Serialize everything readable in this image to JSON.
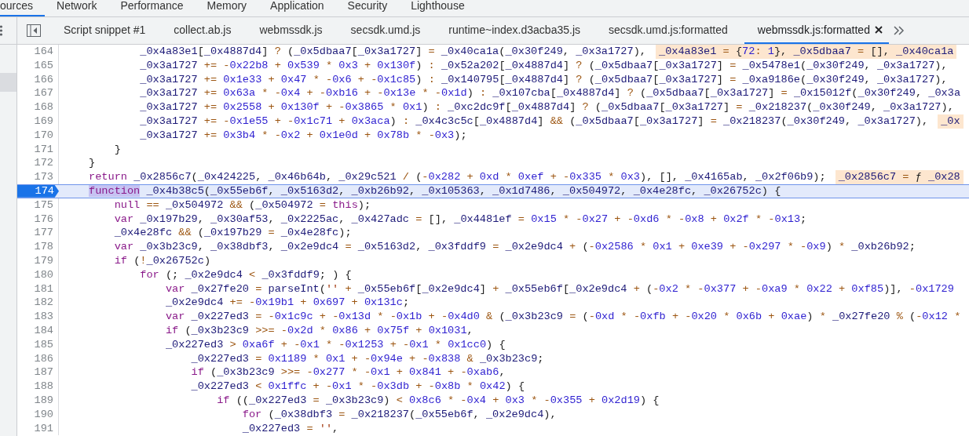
{
  "panel_tabs": [
    {
      "label": "ources",
      "selected": true
    },
    {
      "label": "Network",
      "selected": false
    },
    {
      "label": "Performance",
      "selected": false
    },
    {
      "label": "Memory",
      "selected": false
    },
    {
      "label": "Application",
      "selected": false
    },
    {
      "label": "Security",
      "selected": false
    },
    {
      "label": "Lighthouse",
      "selected": false
    }
  ],
  "sidebar": {
    "rows": [
      {
        "selected": true
      }
    ]
  },
  "file_tabs": [
    {
      "label": "Script snippet #1",
      "selected": false
    },
    {
      "label": "collect.ab.js",
      "selected": false
    },
    {
      "label": "webmssdk.js",
      "selected": false
    },
    {
      "label": "secsdk.umd.js",
      "selected": false
    },
    {
      "label": "runtime~index.d3acba35.js",
      "selected": false
    },
    {
      "label": "secsdk.umd.js:formatted",
      "selected": false
    },
    {
      "label": "webmssdk.js:formatted",
      "selected": true
    }
  ],
  "editor": {
    "lines": [
      {
        "number": "164",
        "breakpoint": false,
        "text": "        _0x4a83e1[_0x4887d4] ? (_0x5dbaa7[_0x3a1727] = _0x40ca1a(_0x30f249, _0x3a1727),",
        "inline_value": "_0x4a83e1 = {72: 1}, _0x5dbaa7 = [], _0x40ca1a"
      },
      {
        "number": "165",
        "breakpoint": false,
        "text": "        _0x3a1727 += -0x22b8 + 0x539 * 0x3 + 0x130f) : _0x52a202[_0x4887d4] ? (_0x5dbaa7[_0x3a1727] = _0x5478e1(_0x30f249, _0x3a1727),"
      },
      {
        "number": "166",
        "breakpoint": false,
        "text": "        _0x3a1727 += 0x1e33 + 0x47 * -0x6 + -0x1c85) : _0x140795[_0x4887d4] ? (_0x5dbaa7[_0x3a1727] = _0xa9186e(_0x30f249, _0x3a1727),"
      },
      {
        "number": "167",
        "breakpoint": false,
        "text": "        _0x3a1727 += 0x63a * -0x4 + -0xb16 + -0x13e * -0x1d) : _0x107cba[_0x4887d4] ? (_0x5dbaa7[_0x3a1727] = _0x15012f(_0x30f249, _0x3a"
      },
      {
        "number": "168",
        "breakpoint": false,
        "text": "        _0x3a1727 += 0x2558 + 0x130f + -0x3865 * 0x1) : _0xc2dc9f[_0x4887d4] ? (_0x5dbaa7[_0x3a1727] = _0x218237(_0x30f249, _0x3a1727),"
      },
      {
        "number": "169",
        "breakpoint": false,
        "text": "        _0x3a1727 += -0x1e55 + -0x1c71 + 0x3aca) : _0x4c3c5c[_0x4887d4] && (_0x5dbaa7[_0x3a1727] = _0x218237(_0x30f249, _0x3a1727),",
        "inline_value": "_0x"
      },
      {
        "number": "170",
        "breakpoint": false,
        "text": "        _0x3a1727 += 0x3b4 * -0x2 + 0x1e0d + 0x78b * -0x3);"
      },
      {
        "number": "171",
        "breakpoint": false,
        "text": "    }"
      },
      {
        "number": "172",
        "breakpoint": false,
        "text": "}"
      },
      {
        "number": "173",
        "breakpoint": false,
        "text": "return _0x2856c7(_0x424225, _0x46b64b, _0x29c521 / (-0x282 + 0xd * 0xef + -0x335 * 0x3), [], _0x4165ab, _0x2f06b9);",
        "inline_value": "_0x2856c7 = ƒ _0x28"
      },
      {
        "number": "174",
        "breakpoint": true,
        "match": "function",
        "text": " _0x4b38c5(_0x55eb6f, _0x5163d2, _0xb26b92, _0x105363, _0x1d7486, _0x504972, _0x4e28fc, _0x26752c) {"
      },
      {
        "number": "175",
        "breakpoint": false,
        "text": "    null == _0x504972 && (_0x504972 = this);"
      },
      {
        "number": "176",
        "breakpoint": false,
        "text": "    var _0x197b29, _0x30af53, _0x2225ac, _0x427adc = [], _0x4481ef = 0x15 * -0x27 + -0xd6 * -0x8 + 0x2f * -0x13;"
      },
      {
        "number": "177",
        "breakpoint": false,
        "text": "    _0x4e28fc && (_0x197b29 = _0x4e28fc);"
      },
      {
        "number": "178",
        "breakpoint": false,
        "text": "    var _0x3b23c9, _0x38dbf3, _0x2e9dc4 = _0x5163d2, _0x3fddf9 = _0x2e9dc4 + (-0x2586 * 0x1 + 0xe39 + -0x297 * -0x9) * _0xb26b92;"
      },
      {
        "number": "179",
        "breakpoint": false,
        "text": "    if (!_0x26752c)"
      },
      {
        "number": "180",
        "breakpoint": false,
        "text": "        for (; _0x2e9dc4 < _0x3fddf9; ) {"
      },
      {
        "number": "181",
        "breakpoint": false,
        "text": "            var _0x27fe20 = parseInt('' + _0x55eb6f[_0x2e9dc4] + _0x55eb6f[_0x2e9dc4 + (-0x2 * -0x377 + -0xa9 * 0x22 + 0xf85)], -0x1729"
      },
      {
        "number": "182",
        "breakpoint": false,
        "text": "            _0x2e9dc4 += -0x19b1 + 0x697 + 0x131c;"
      },
      {
        "number": "183",
        "breakpoint": false,
        "text": "            var _0x227ed3 = -0x1c9c + -0x13d * -0x1b + -0x4d0 & (_0x3b23c9 = (-0xd * -0xfb + -0x20 * 0x6b + 0xae) * _0x27fe20 % (-0x12 *"
      },
      {
        "number": "184",
        "breakpoint": false,
        "text": "            if (_0x3b23c9 >>= -0x2d * 0x86 + 0x75f + 0x1031,"
      },
      {
        "number": "185",
        "breakpoint": false,
        "text": "            _0x227ed3 > 0xa6f + -0x1 * -0x1253 + -0x1 * 0x1cc0) {"
      },
      {
        "number": "186",
        "breakpoint": false,
        "text": "                _0x227ed3 = 0x1189 * 0x1 + -0x94e + -0x838 & _0x3b23c9;"
      },
      {
        "number": "187",
        "breakpoint": false,
        "text": "                if (_0x3b23c9 >>= -0x277 * -0x1 + 0x841 + -0xab6,"
      },
      {
        "number": "188",
        "breakpoint": false,
        "text": "                _0x227ed3 < 0x1ffc + -0x1 * -0x3db + -0x8b * 0x42) {"
      },
      {
        "number": "189",
        "breakpoint": false,
        "text": "                    if ((_0x227ed3 = _0x3b23c9) < 0x8c6 * -0x4 + 0x3 * -0x355 + 0x2d19) {"
      },
      {
        "number": "190",
        "breakpoint": false,
        "text": "                        for (_0x38dbf3 = _0x218237(_0x55eb6f, _0x2e9dc4),"
      },
      {
        "number": "191",
        "breakpoint": false,
        "text": "                        _0x227ed3 = '',"
      }
    ]
  }
}
